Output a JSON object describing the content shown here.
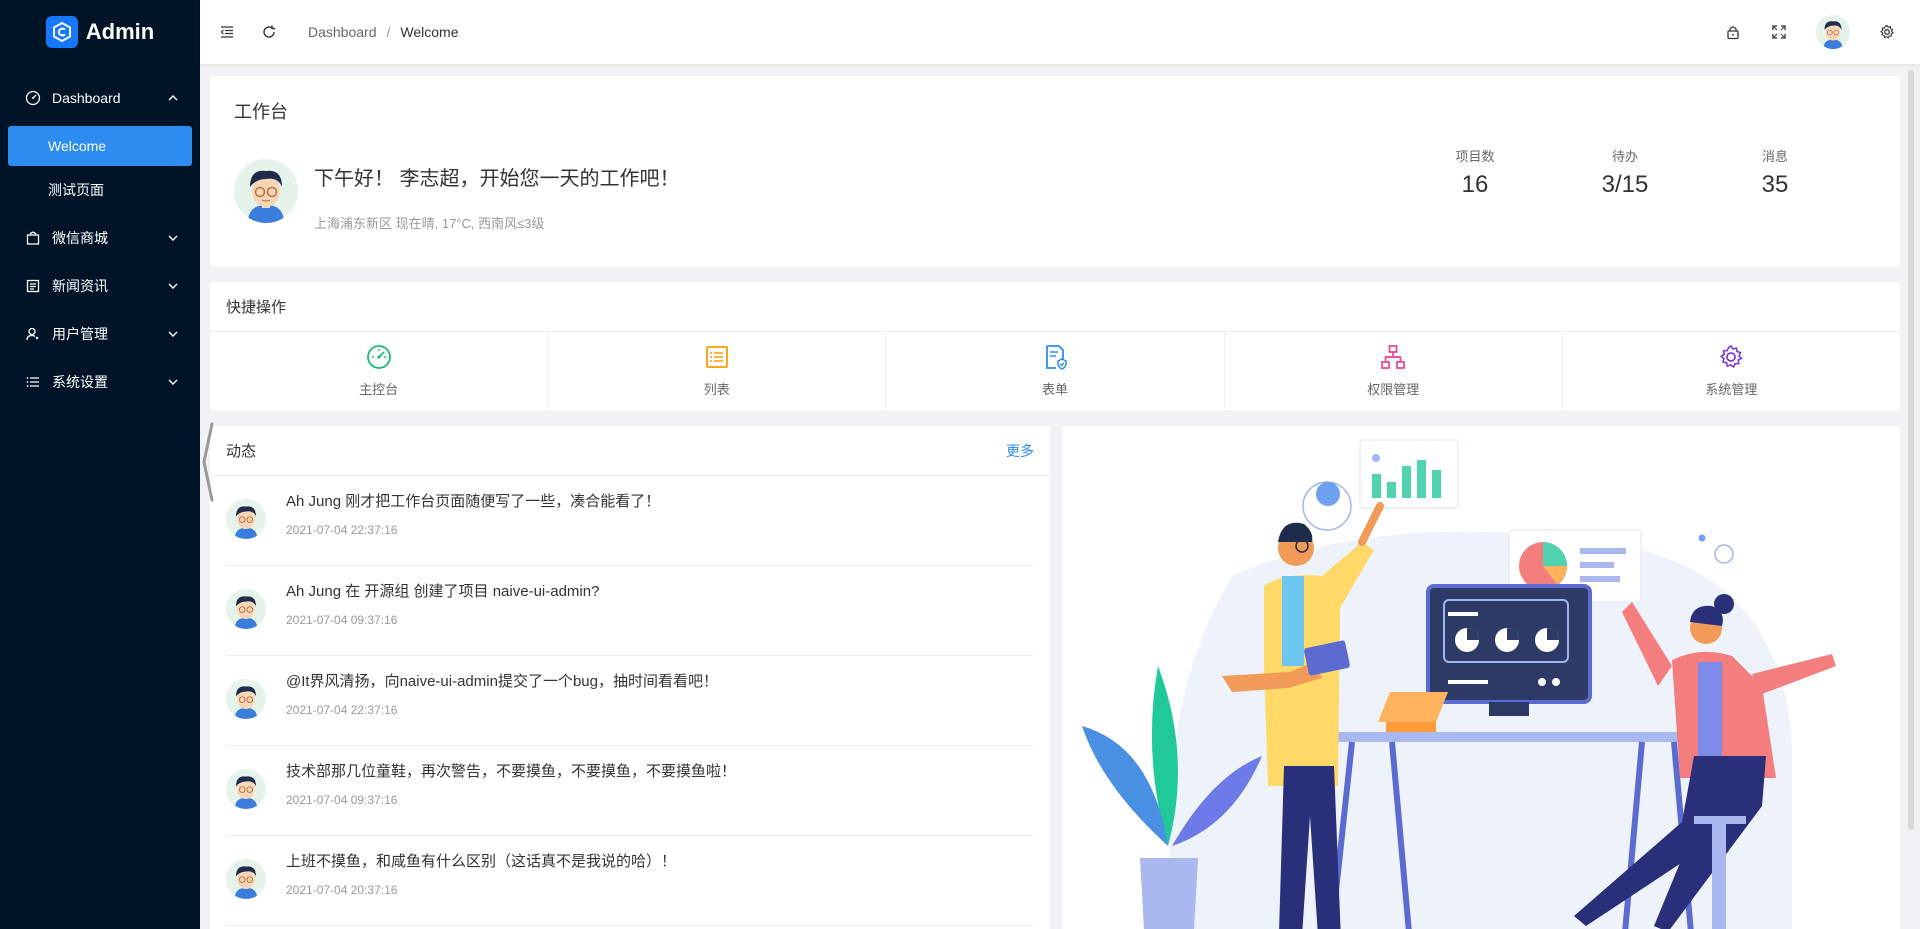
{
  "app": {
    "name": "Admin"
  },
  "colors": {
    "sidebar_bg": "#001428",
    "primary": "#2d8cf0",
    "active_menu": "#2d8cf0"
  },
  "sidebar": {
    "items": [
      {
        "label": "Dashboard",
        "icon": "dashboard-icon",
        "expanded": true,
        "children": [
          {
            "label": "Welcome",
            "active": true
          },
          {
            "label": "测试页面"
          }
        ]
      },
      {
        "label": "微信商城",
        "icon": "shopping-bag-icon"
      },
      {
        "label": "新闻资讯",
        "icon": "news-icon"
      },
      {
        "label": "用户管理",
        "icon": "user-manage-icon"
      },
      {
        "label": "系统设置",
        "icon": "list-settings-icon"
      }
    ]
  },
  "header": {
    "breadcrumb": [
      "Dashboard",
      "Welcome"
    ],
    "breadcrumb_separator": "/",
    "icons": [
      "menu-fold-icon",
      "refresh-icon",
      "lock-icon",
      "fullscreen-icon",
      "avatar",
      "settings-icon"
    ]
  },
  "workbench": {
    "title": "工作台",
    "greeting": "下午好！ 李志超，开始您一天的工作吧！",
    "weather": "上海浦东新区 现在晴, 17°C, 西南风≤3级",
    "stats": [
      {
        "label": "项目数",
        "value": "16"
      },
      {
        "label": "待办",
        "value": "3/15"
      },
      {
        "label": "消息",
        "value": "35"
      }
    ]
  },
  "quick_actions": {
    "title": "快捷操作",
    "items": [
      {
        "label": "主控台",
        "icon": "dashboard-gauge-icon",
        "color": "#19be6b"
      },
      {
        "label": "列表",
        "icon": "list-icon",
        "color": "#ff9900"
      },
      {
        "label": "表单",
        "icon": "form-check-icon",
        "color": "#2d8cf0"
      },
      {
        "label": "权限管理",
        "icon": "org-chart-icon",
        "color": "#ed4192"
      },
      {
        "label": "系统管理",
        "icon": "gear-icon",
        "color": "#9a60b4"
      }
    ]
  },
  "activity": {
    "title": "动态",
    "more": "更多",
    "items": [
      {
        "text": "Ah Jung 刚才把工作台页面随便写了一些，凑合能看了！",
        "time": "2021-07-04 22:37:16"
      },
      {
        "text": "Ah Jung 在 开源组 创建了项目 naive-ui-admin?",
        "time": "2021-07-04 09:37:16"
      },
      {
        "text": "@It界风清扬，向naive-ui-admin提交了一个bug，抽时间看看吧！",
        "time": "2021-07-04 22:37:16"
      },
      {
        "text": "技术部那几位童鞋，再次警告，不要摸鱼，不要摸鱼，不要摸鱼啦！",
        "time": "2021-07-04 09:37:16"
      },
      {
        "text": "上班不摸鱼，和咸鱼有什么区别（这话真不是我说的哈）！",
        "time": "2021-07-04 20:37:16"
      }
    ]
  }
}
